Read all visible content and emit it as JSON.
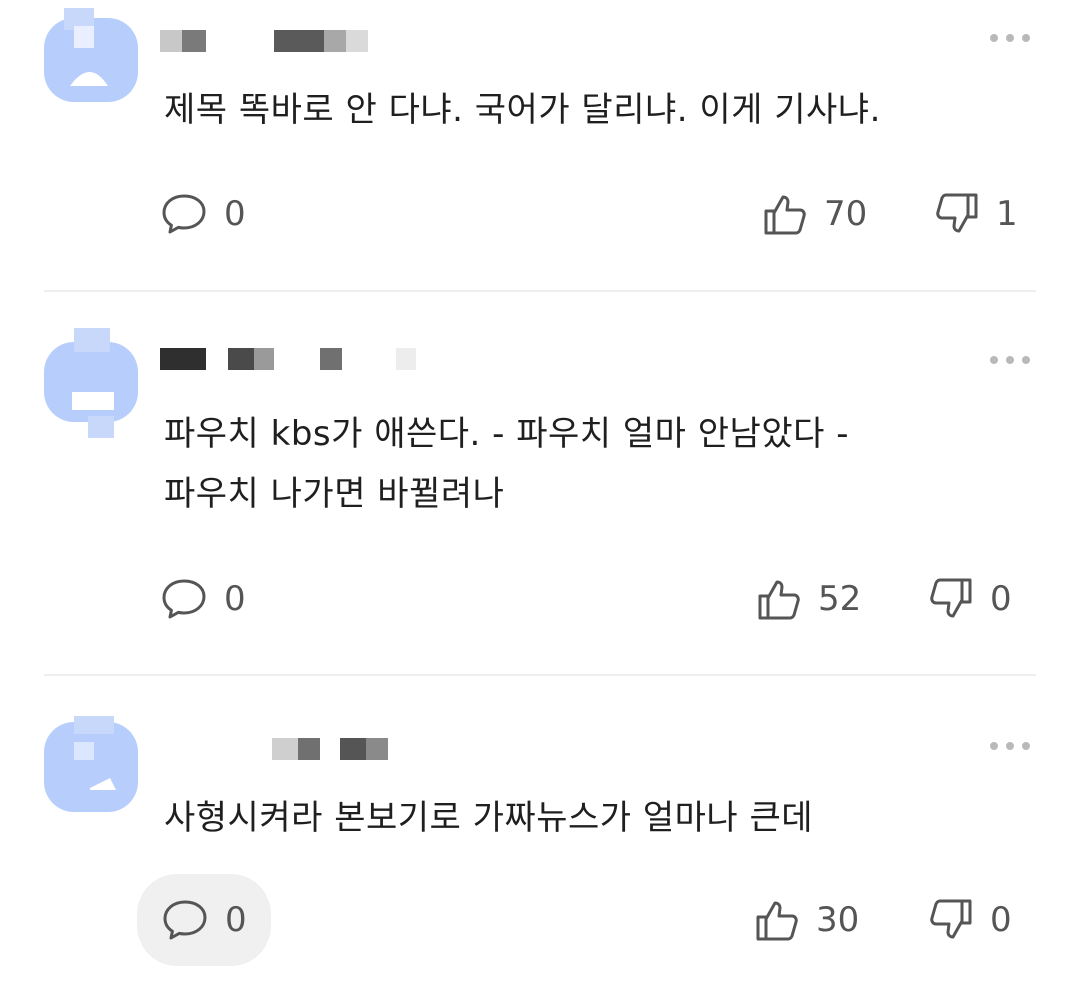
{
  "comments": [
    {
      "text": "제목 똑바로 안 다냐. 국어가 달리냐. 이게 기사냐.",
      "replies": "0",
      "likes": "70",
      "dislikes": "1"
    },
    {
      "text": "파우치 kbs가 애쓴다. - 파우치 얼마 안남았다 -\n파우치 나가면 바뀔려나",
      "replies": "0",
      "likes": "52",
      "dislikes": "0"
    },
    {
      "text": "사형시켜라 본보기로 가짜뉴스가 얼마나 큰데",
      "replies": "0",
      "likes": "30",
      "dislikes": "0"
    }
  ],
  "colors": {
    "avatar": "#b7cdfb",
    "icon": "#555555",
    "divider": "#eeeeee"
  },
  "icons": [
    "reply-icon",
    "thumbs-up-icon",
    "thumbs-down-icon",
    "more-icon"
  ]
}
